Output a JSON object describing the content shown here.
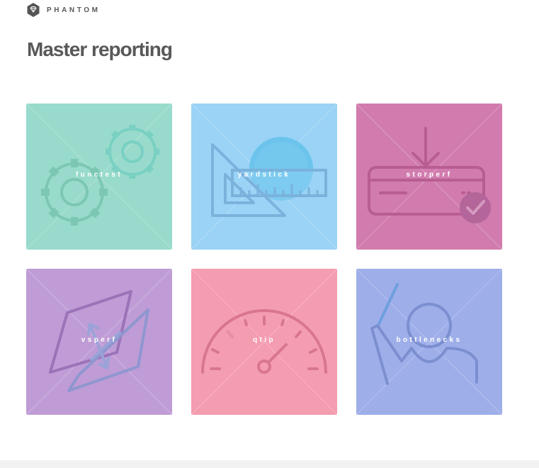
{
  "header": {
    "brand": "PHANTOM",
    "title": "Master reporting"
  },
  "tiles": [
    {
      "label": "functest",
      "icon": "gears-icon",
      "color": "#98dacb"
    },
    {
      "label": "yardstick",
      "icon": "ruler-triangle-icon",
      "color": "#9ad3f6"
    },
    {
      "label": "storperf",
      "icon": "storage-download-icon",
      "color": "#d17bae"
    },
    {
      "label": "vsperf",
      "icon": "switch-planes-icon",
      "color": "#bf9cd5"
    },
    {
      "label": "qtip",
      "icon": "speedometer-icon",
      "color": "#f49cb0"
    },
    {
      "label": "bottlenecks",
      "icon": "person-reaching-icon",
      "color": "#9eaee9"
    }
  ]
}
